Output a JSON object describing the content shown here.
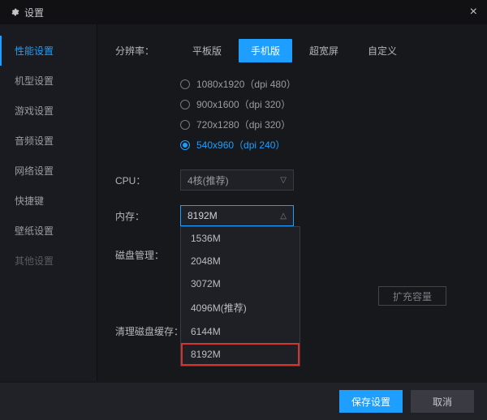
{
  "title": "设置",
  "sidebar": [
    {
      "label": "性能设置",
      "active": true
    },
    {
      "label": "机型设置"
    },
    {
      "label": "游戏设置"
    },
    {
      "label": "音频设置"
    },
    {
      "label": "网络设置"
    },
    {
      "label": "快捷键"
    },
    {
      "label": "壁纸设置"
    },
    {
      "label": "其他设置",
      "muted": true
    }
  ],
  "resolution": {
    "label": "分辨率：",
    "modes": [
      {
        "label": "平板版"
      },
      {
        "label": "手机版",
        "active": true
      },
      {
        "label": "超宽屏"
      },
      {
        "label": "自定义"
      }
    ],
    "options": [
      {
        "label": "1080x1920（dpi 480）"
      },
      {
        "label": "900x1600（dpi 320）"
      },
      {
        "label": "720x1280（dpi 320）"
      },
      {
        "label": "540x960（dpi 240）",
        "checked": true
      }
    ]
  },
  "cpu": {
    "label": "CPU：",
    "value": "4核(推荐)"
  },
  "memory": {
    "label": "内存：",
    "value": "8192M",
    "options": [
      "1536M",
      "2048M",
      "3072M",
      "4096M(推荐)",
      "6144M",
      "8192M"
    ],
    "highlight": "8192M"
  },
  "disk": {
    "label": "磁盘管理：",
    "button": "扩充容量"
  },
  "clear_cache": {
    "label": "清理磁盘缓存："
  },
  "footer": {
    "save": "保存设置",
    "cancel": "取消"
  }
}
